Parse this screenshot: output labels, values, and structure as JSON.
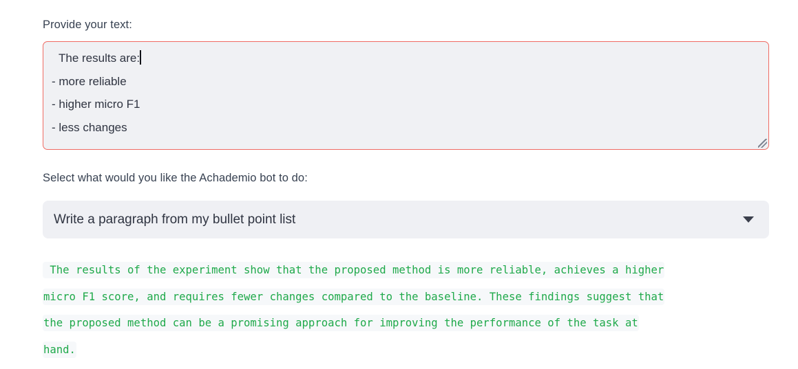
{
  "form": {
    "text_input": {
      "label": "Provide your text:",
      "value_lines": [
        "The results are:",
        "- more reliable",
        "- higher micro F1",
        "- less changes"
      ],
      "placeholder": "",
      "border_color": "#ef6a62",
      "background_color": "#f0f1f4",
      "has_caret": true,
      "resize_handle_icon": "resize-grip-icon"
    },
    "task_select": {
      "label": "Select what would you like the Achademio bot to do:",
      "selected": "Write a paragraph from my bullet point list",
      "chevron_icon": "chevron-down-icon",
      "background_color": "#eff0f4"
    }
  },
  "output": {
    "text_color": "#1fa94a",
    "highlight_color": "#f6f8fa",
    "lines": [
      " The results of the experiment show that the proposed method is more reliable, achieves a higher",
      "micro F1 score, and requires fewer changes compared to the baseline. These findings suggest that",
      "the proposed method can be a promising approach for improving the performance of the task at",
      "hand."
    ]
  }
}
